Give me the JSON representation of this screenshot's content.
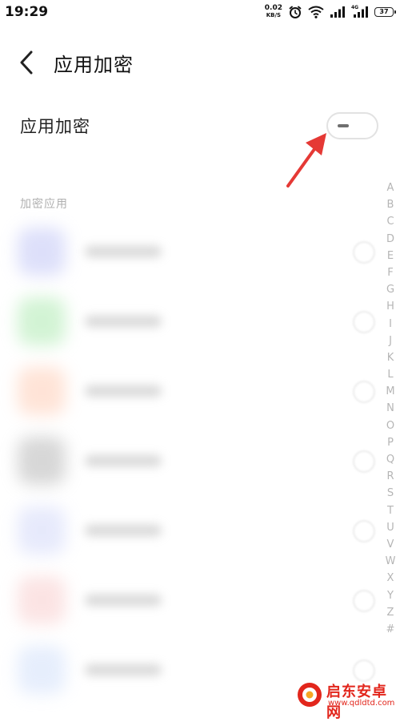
{
  "status_bar": {
    "time": "19:29",
    "net_speed_value": "0.02",
    "net_speed_unit": "KB/S",
    "network_type": "4G",
    "battery_level": "37"
  },
  "header": {
    "title": "应用加密"
  },
  "setting": {
    "label": "应用加密",
    "enabled": false
  },
  "section": {
    "title": "加密应用"
  },
  "app_list": {
    "icon_colors": [
      "#c7cbf7",
      "#b5ecb8",
      "#ffd2bd",
      "#bdbdbd",
      "#d7dcfa",
      "#f9d2d2",
      "#d6e3fb"
    ]
  },
  "alphabet_index": [
    "A",
    "B",
    "C",
    "D",
    "E",
    "F",
    "G",
    "H",
    "I",
    "J",
    "K",
    "L",
    "M",
    "N",
    "O",
    "P",
    "Q",
    "R",
    "S",
    "T",
    "U",
    "V",
    "W",
    "X",
    "Y",
    "Z",
    "#"
  ],
  "watermark": {
    "name": "启东安卓网",
    "url": "www.qdldtd.com"
  },
  "colors": {
    "annotation_arrow": "#e53935",
    "watermark_red": "#e2261c"
  }
}
